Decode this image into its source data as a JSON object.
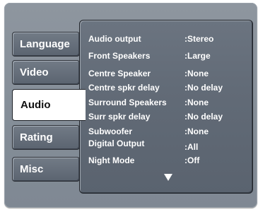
{
  "tabs": [
    {
      "label": "Language"
    },
    {
      "label": "Video"
    },
    {
      "label": "Audio",
      "active": true
    },
    {
      "label": "Rating"
    },
    {
      "label": "Misc"
    }
  ],
  "settings": [
    {
      "label": "Audio output",
      "value": ":Stereo"
    },
    {
      "label": "Front Speakers",
      "value": ":Large"
    },
    {
      "label": "Centre Speaker",
      "value": ":None"
    },
    {
      "label": "Centre spkr delay",
      "value": ":No delay"
    },
    {
      "label": "Surround Speakers",
      "value": ":None"
    },
    {
      "label": "Surr spkr delay",
      "value": ":No delay"
    },
    {
      "label": "Subwoofer",
      "value": ":None"
    },
    {
      "label": "Digital Output",
      "value": ":All"
    },
    {
      "label": "Night  Mode",
      "value": ":Off"
    }
  ],
  "icons": {
    "scroll_down": "down-triangle-icon"
  }
}
